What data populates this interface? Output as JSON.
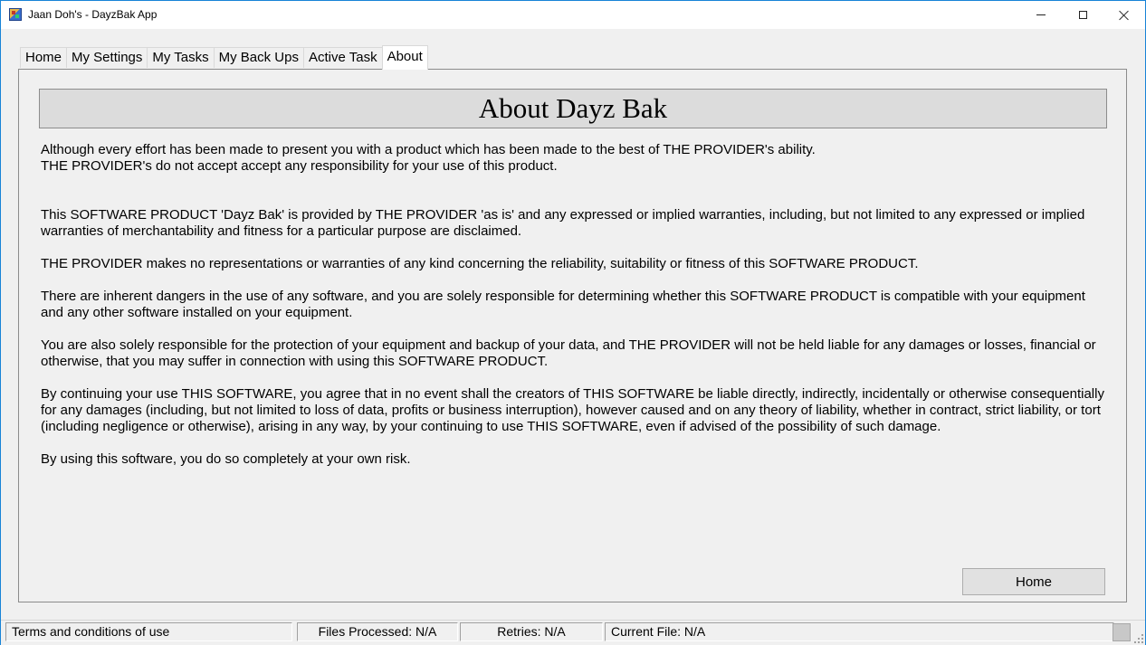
{
  "window": {
    "title": "Jaan Doh's - DayzBak App",
    "icon": "app-icon",
    "controls": {
      "minimize": "minimize-icon",
      "maximize": "maximize-icon",
      "close": "close-icon"
    }
  },
  "tabs": [
    {
      "label": "Home"
    },
    {
      "label": "My Settings"
    },
    {
      "label": "My Tasks"
    },
    {
      "label": "My Back Ups"
    },
    {
      "label": "Active Task"
    },
    {
      "label": "About",
      "active": true
    }
  ],
  "about": {
    "heading": "About Dayz Bak",
    "intro_line1": "Although every effort has been made to present you with a product which has been made to the best of THE PROVIDER's ability.",
    "intro_line2": "THE PROVIDER's do not accept accept any responsibility for your use of this product.",
    "paragraphs": [
      "This SOFTWARE PRODUCT 'Dayz Bak' is provided by THE PROVIDER 'as is' and any expressed or implied warranties, including, but not limited to any expressed or implied warranties of merchantability and fitness for a particular purpose are disclaimed.",
      "THE PROVIDER makes no representations or warranties of any kind concerning the reliability, suitability or fitness of this SOFTWARE PRODUCT.",
      "There are inherent dangers in the use of any software, and you are solely responsible for determining whether this SOFTWARE PRODUCT is compatible with your equipment and any other software installed on your equipment.",
      "You are also solely responsible for the protection of your equipment and backup of your data, and THE PROVIDER will not be held liable for any damages or losses, financial or otherwise, that you may suffer in connection with using this SOFTWARE PRODUCT.",
      "By continuing your use THIS SOFTWARE, you agree that in no event shall the creators of THIS SOFTWARE be liable directly, indirectly, incidentally or otherwise consequentially for any damages (including, but not limited to loss of data, profits or business interruption), however caused and on any theory of liability, whether in contract, strict liability, or tort (including negligence or otherwise), arising in any way, by your continuing to use THIS SOFTWARE, even if advised of the possibility of such damage.",
      "By using this software, you do so completely at your own risk."
    ],
    "home_button": "Home"
  },
  "statusbar": {
    "terms": "Terms and conditions of use",
    "files_processed": "Files Processed: N/A",
    "retries": "Retries: N/A",
    "current_file": "Current File: N/A"
  }
}
